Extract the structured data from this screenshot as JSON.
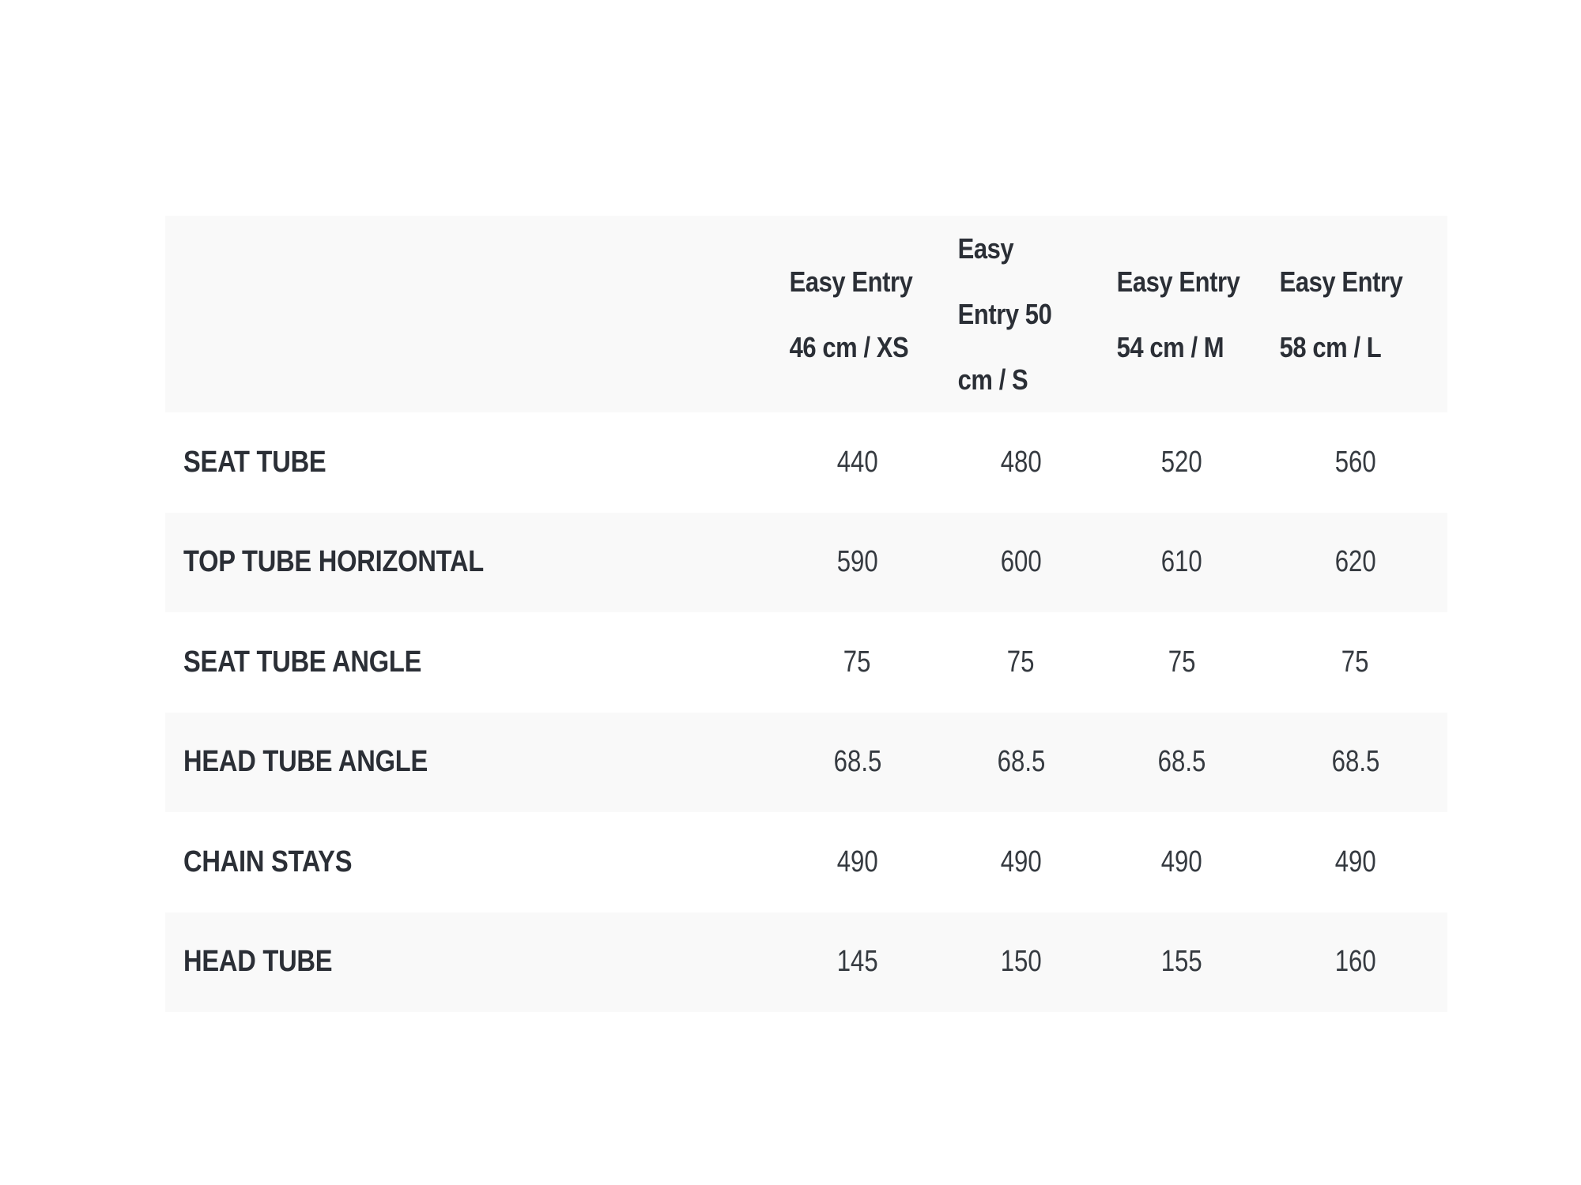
{
  "table": {
    "columns": [
      "Easy Entry 46 cm / XS",
      "Easy Entry 50 cm / S",
      "Easy Entry 54 cm / M",
      "Easy Entry 58 cm / L"
    ],
    "rows": [
      {
        "label": "SEAT TUBE",
        "values": [
          "440",
          "480",
          "520",
          "560"
        ]
      },
      {
        "label": "TOP TUBE HORIZONTAL",
        "values": [
          "590",
          "600",
          "610",
          "620"
        ]
      },
      {
        "label": "SEAT TUBE ANGLE",
        "values": [
          "75",
          "75",
          "75",
          "75"
        ]
      },
      {
        "label": "HEAD TUBE ANGLE",
        "values": [
          "68.5",
          "68.5",
          "68.5",
          "68.5"
        ]
      },
      {
        "label": "CHAIN STAYS",
        "values": [
          "490",
          "490",
          "490",
          "490"
        ]
      },
      {
        "label": "HEAD TUBE",
        "values": [
          "145",
          "150",
          "155",
          "160"
        ]
      }
    ]
  }
}
